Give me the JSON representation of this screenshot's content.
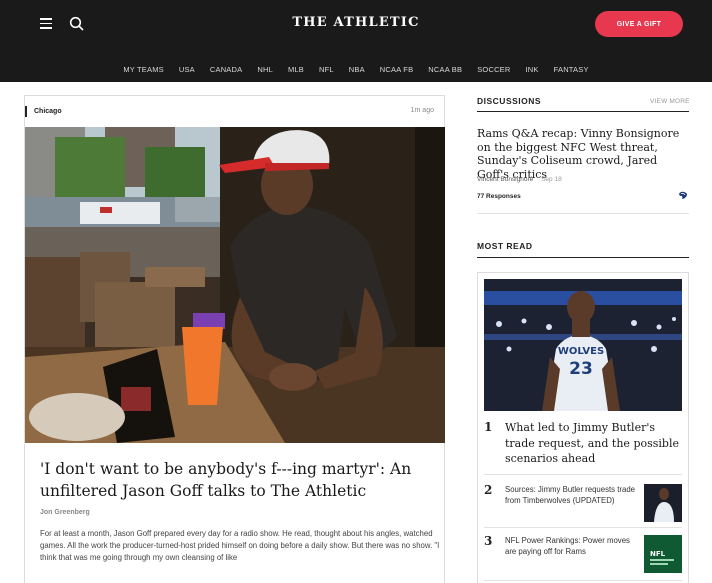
{
  "header": {
    "brand": "THE ATHLETIC",
    "gift_label": "GIVE A GIFT",
    "nav": [
      "MY TEAMS",
      "USA",
      "CANADA",
      "NHL",
      "MLB",
      "NFL",
      "NBA",
      "NCAA FB",
      "NCAA BB",
      "SOCCER",
      "INK",
      "FANTASY"
    ]
  },
  "feature": {
    "location": "Chicago",
    "time": "1m ago",
    "headline": "'I don't want to be anybody's f---ing martyr': An unfiltered Jason Goff talks to The Athletic",
    "author": "Jon Greenberg",
    "excerpt": "For at least a month, Jason Goff prepared every day for a radio show. He read, thought about his angles, watched games. All the work the producer-turned-host prided himself on doing before a daily show.  But there was no show. \"I think that was me going through my own cleansing of like"
  },
  "discussions": {
    "title": "DISCUSSIONS",
    "view_more": "VIEW MORE",
    "item": {
      "title": "Rams Q&A recap: Vinny Bonsignore on the biggest NFC West threat, Sunday's Coliseum crowd, Jared Goff's critics",
      "author": "Vincent Bonsignore",
      "date": "Sep 18",
      "responses": "77 Responses"
    }
  },
  "most_read": {
    "title": "MOST READ",
    "items": [
      {
        "rank": "1",
        "title": "What led to Jimmy Butler's trade request, and the possible scenarios ahead"
      },
      {
        "rank": "2",
        "title": "Sources: Jimmy Butler requests trade from Timberwolves (UPDATED)"
      },
      {
        "rank": "3",
        "title": "NFL Power Rankings: Power moves are paying off for Rams"
      }
    ],
    "jersey_text": "WOLVES",
    "jersey_number": "23",
    "thumb3_text": "NFL"
  },
  "colors": {
    "header_bg": "#1a1a1a",
    "gift_button": "#e8384f",
    "thumb_green": "#0f5a32"
  }
}
